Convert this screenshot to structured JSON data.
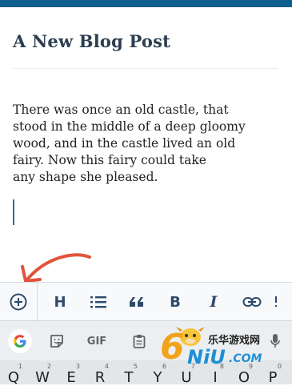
{
  "post": {
    "title": "A New Blog Post",
    "body": "There was once an old castle, that\nstood in the middle of a deep gloomy\nwood, and in the castle lived an old\nfairy. Now this fairy could take\nany shape she pleased."
  },
  "format_toolbar": {
    "add_block": "plus-circle-icon",
    "heading_label": "H",
    "list": "list-icon",
    "quote_label": "“",
    "bold_label": "B",
    "italic_label": "I",
    "link": "link-icon"
  },
  "keyboard": {
    "google_label": "G",
    "gif_label": "GIF",
    "keys": [
      {
        "num": "1",
        "ch": "Q"
      },
      {
        "num": "2",
        "ch": "W"
      },
      {
        "num": "3",
        "ch": "E"
      },
      {
        "num": "4",
        "ch": "R"
      },
      {
        "num": "5",
        "ch": "T"
      },
      {
        "num": "6",
        "ch": "Y"
      },
      {
        "num": "7",
        "ch": "U"
      },
      {
        "num": "8",
        "ch": "I"
      },
      {
        "num": "9",
        "ch": "O"
      },
      {
        "num": "0",
        "ch": "P"
      }
    ]
  },
  "watermark": {
    "site_name": "乐华游戏网",
    "logo_six": "6",
    "logo_niu": "NiU",
    "logo_com": ".COM"
  },
  "colors": {
    "accent": "#0f5f8e",
    "toolbar_icon": "#2d4b6b",
    "arrow": "#e2533a"
  }
}
